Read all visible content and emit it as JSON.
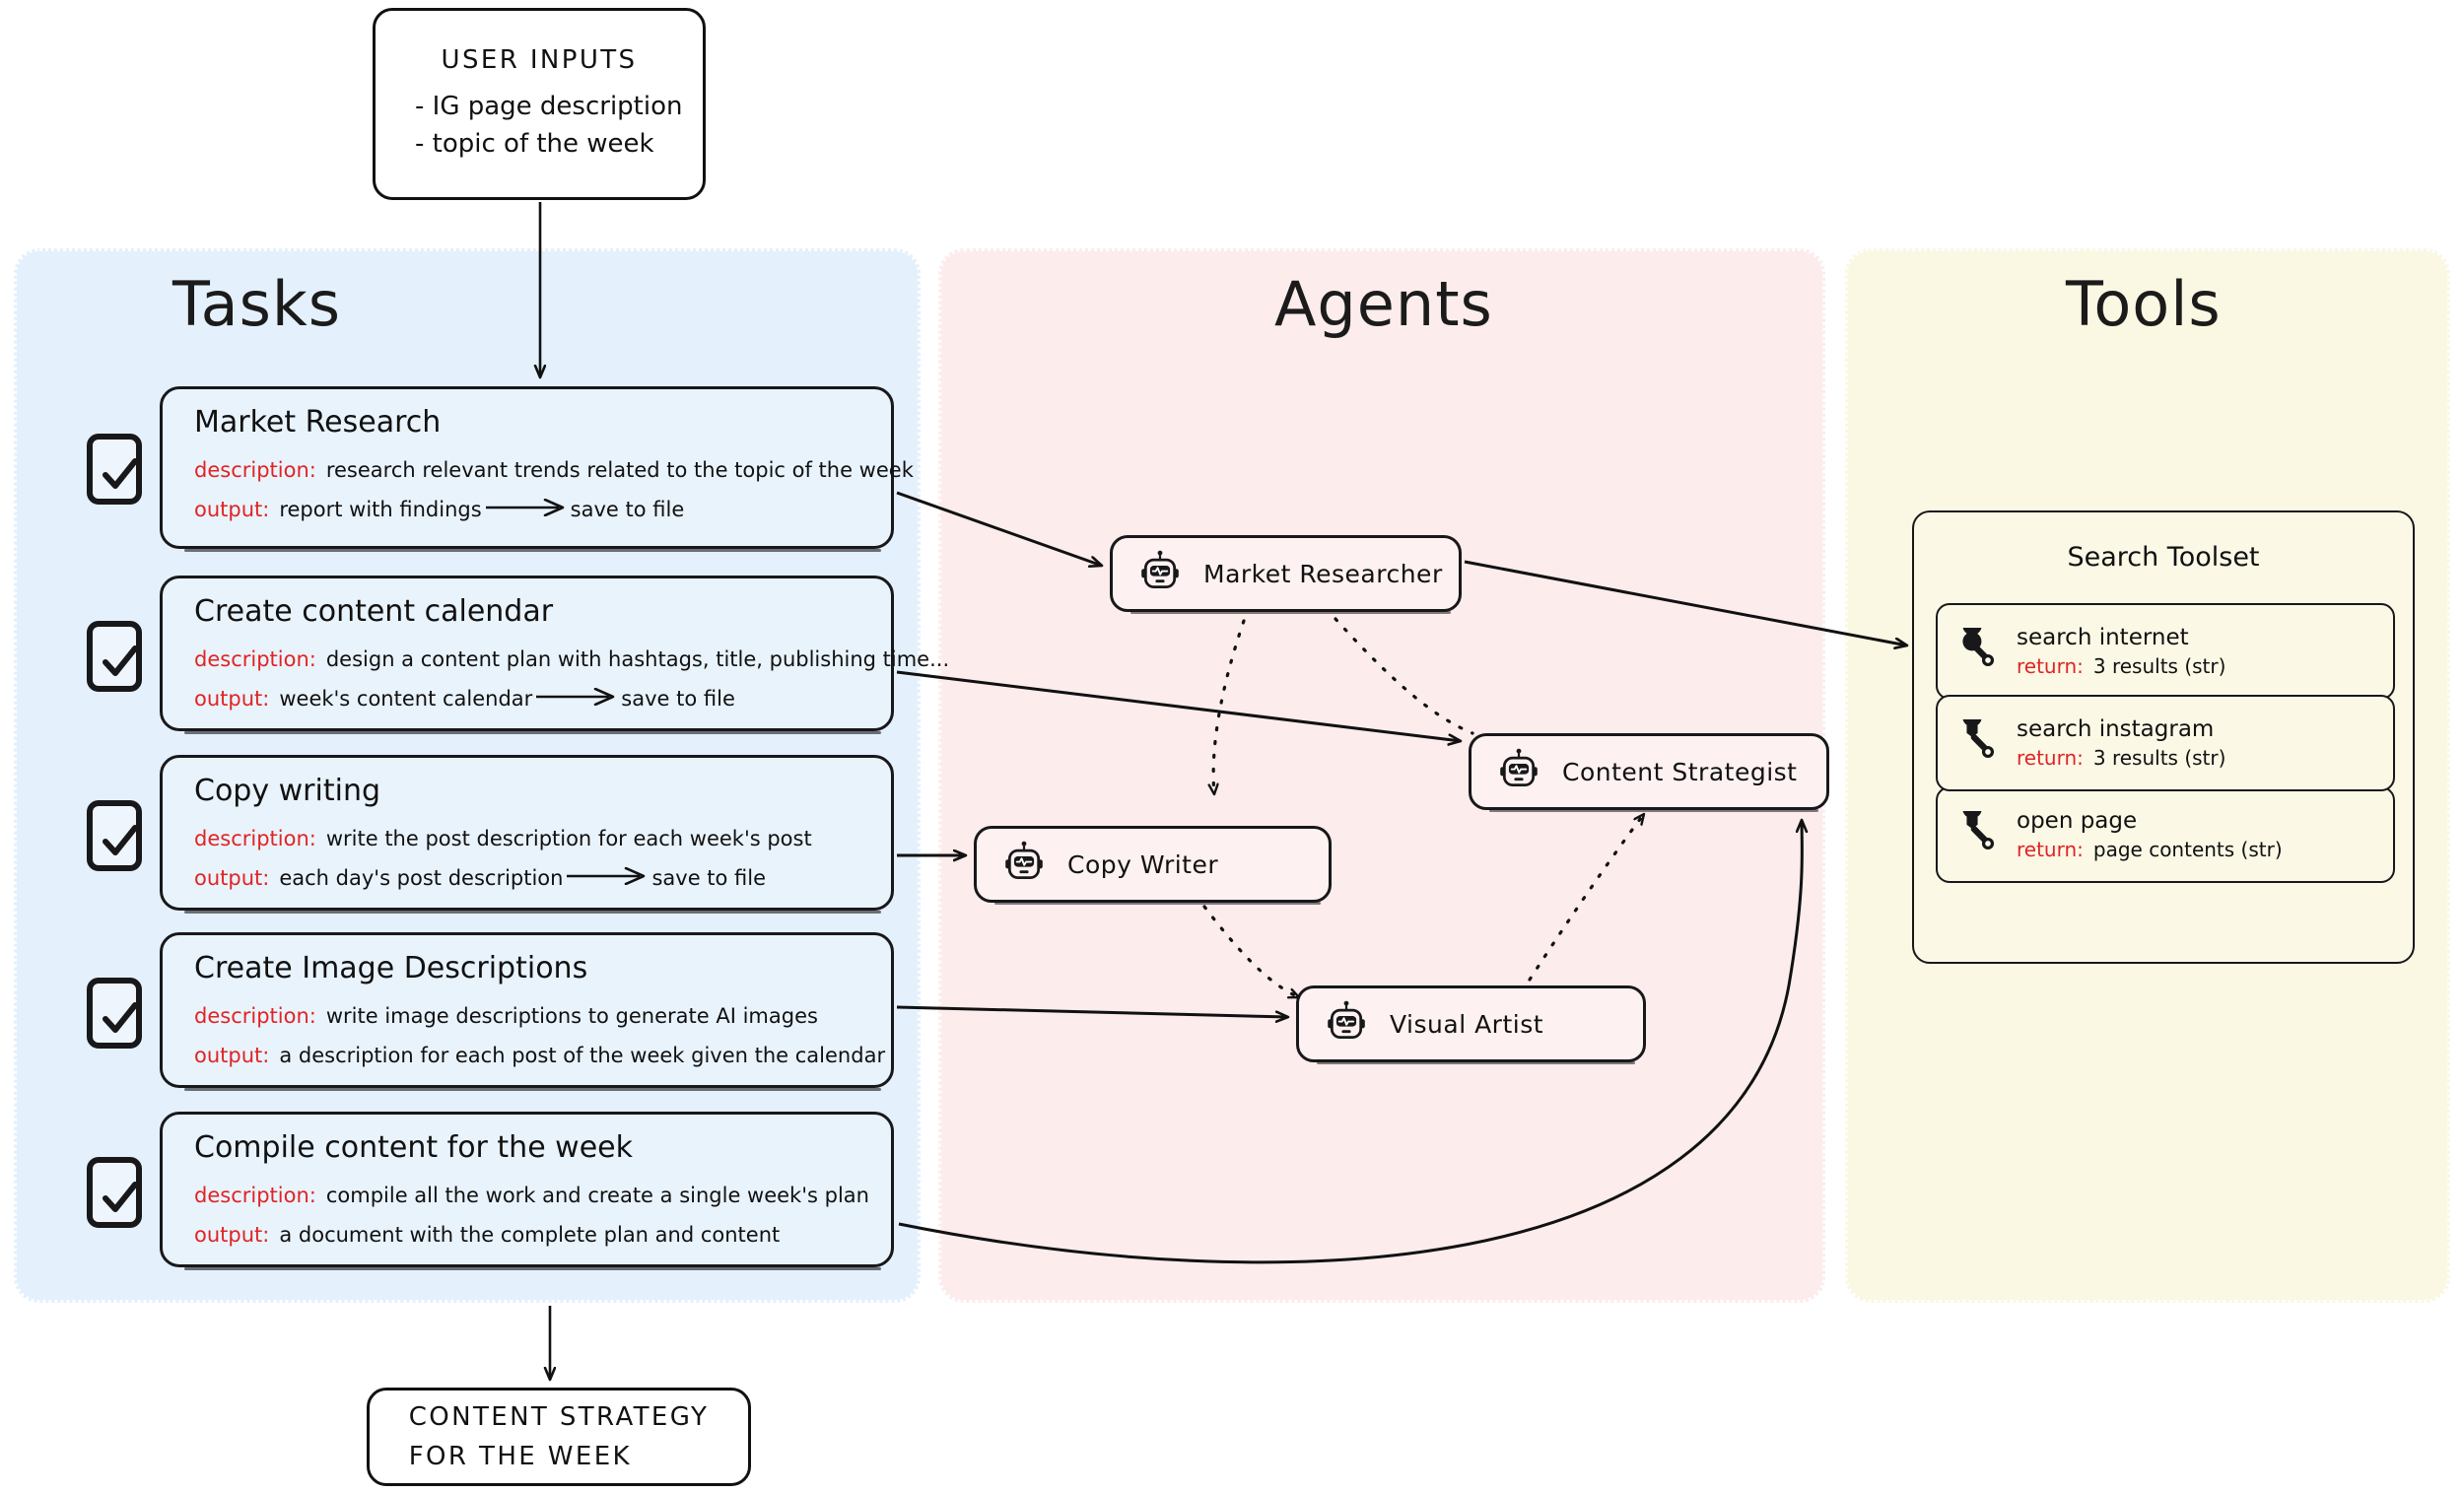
{
  "panels": {
    "tasks_title": "Tasks",
    "agents_title": "Agents",
    "tools_title": "Tools"
  },
  "user_inputs": {
    "title": "USER INPUTS",
    "items": [
      "- IG page description",
      "- topic of the week"
    ]
  },
  "final_output": {
    "line1": "CONTENT STRATEGY",
    "line2": "FOR THE WEEK"
  },
  "labels": {
    "description": "description:",
    "output": "output:",
    "return": "return:",
    "save_to_file": "save to file"
  },
  "tasks": [
    {
      "title": "Market Research",
      "description": "research relevant trends related to the topic of the week",
      "output": "report with findings",
      "output_arrow_target": "save to file",
      "checked": true
    },
    {
      "title": "Create content calendar",
      "description": "design a content plan with hashtags, title, publishing time...",
      "output": "week's content calendar",
      "output_arrow_target": "save to file",
      "checked": true
    },
    {
      "title": "Copy writing",
      "description": "write the post description for each week's post",
      "output": "each day's post description",
      "output_arrow_target": "save to file",
      "checked": true
    },
    {
      "title": "Create Image Descriptions",
      "description": "write image descriptions to generate AI images",
      "output": "a description for each post of the week given the calendar",
      "output_arrow_target": "",
      "checked": true
    },
    {
      "title": "Compile content for the week",
      "description": "compile all the work and create a single week's plan",
      "output": "a document with the complete plan and content",
      "output_arrow_target": "",
      "checked": true
    }
  ],
  "agents": [
    {
      "name": "Market Researcher",
      "icon": "robot-icon"
    },
    {
      "name": "Content Strategist",
      "icon": "robot-icon"
    },
    {
      "name": "Copy Writer",
      "icon": "robot-icon"
    },
    {
      "name": "Visual Artist",
      "icon": "robot-icon"
    }
  ],
  "toolset": {
    "title": "Search Toolset",
    "tools": [
      {
        "name": "search internet",
        "return": "3 results (str)",
        "icon": "wrench-icon"
      },
      {
        "name": "search instagram",
        "return": "3 results (str)",
        "icon": "wrench-icon"
      },
      {
        "name": "open page",
        "return": "page contents (str)",
        "icon": "wrench-icon"
      }
    ]
  },
  "colors": {
    "tasks_panel": "#e4f0fb",
    "agents_panel": "#fcecec",
    "tools_panel": "#faf7e2",
    "keyword_red": "#e02424",
    "ink": "#18181b"
  }
}
